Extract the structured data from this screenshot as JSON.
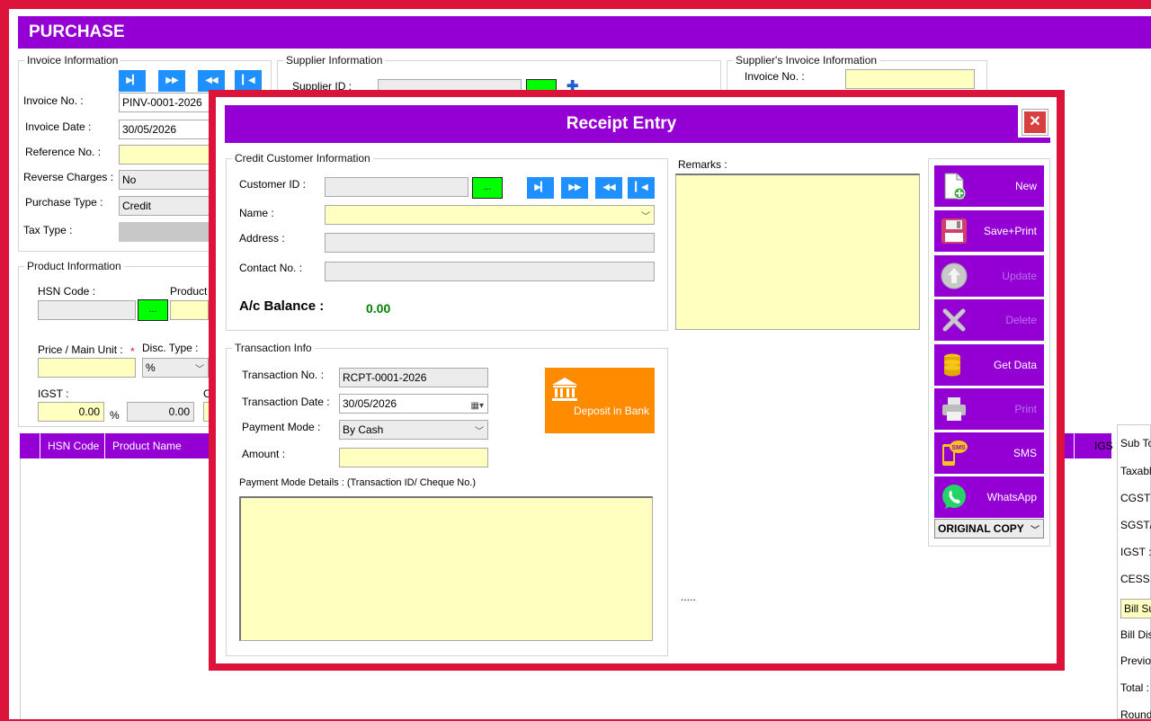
{
  "window": {
    "title": "PURCHASE"
  },
  "invoice": {
    "legend": "Invoice Information",
    "invoice_no_label": "Invoice No. :",
    "invoice_no": "PINV-0001-2026",
    "invoice_date_label": "Invoice Date :",
    "invoice_date": "30/05/2026",
    "reference_no_label": "Reference No. :",
    "reverse_charges_label": "Reverse Charges :",
    "reverse_charges": "No",
    "purchase_type_label": "Purchase Type :",
    "purchase_type": "Credit",
    "tax_type_label": "Tax Type :"
  },
  "supplier": {
    "legend": "Supplier Information",
    "supplier_id_label": "Supplier ID :"
  },
  "supplier_invoice": {
    "legend": "Supplier's Invoice Information",
    "invoice_no_label": "Invoice No. :"
  },
  "product": {
    "legend": "Product Information",
    "hsn_label": "HSN Code :",
    "product_label": "Product",
    "price_label": "Price / Main Unit :",
    "required_mark": "*",
    "disc_type_label": "Disc. Type :",
    "disc_type": "%",
    "igst_label": "IGST :",
    "igst_value": "0.00",
    "percent": "%",
    "second_value": "0.00",
    "c_label": "C"
  },
  "grid": {
    "columns": [
      "HSN Code",
      "Product Name"
    ],
    "right_column": "IGS"
  },
  "totals": {
    "labels": [
      "Sub To",
      "Taxabl",
      "CGST :",
      "SGST/U",
      "IGST :",
      "CESS :",
      "Bill Su",
      "Bill Dis",
      "Previou",
      "Total :",
      "Round"
    ]
  },
  "receipt": {
    "title": "Receipt Entry",
    "customer": {
      "legend": "Credit Customer Information",
      "customer_id_label": "Customer ID :",
      "browse": "...",
      "name_label": "Name :",
      "address_label": "Address :",
      "contact_label": "Contact No. :",
      "balance_label": "A/c Balance :",
      "balance": "0.00"
    },
    "remarks_label": "Remarks :",
    "transaction": {
      "legend": "Transaction Info",
      "no_label": "Transaction No. :",
      "no": "RCPT-0001-2026",
      "date_label": "Transaction Date :",
      "date": "30/05/2026",
      "mode_label": "Payment Mode :",
      "mode": "By Cash",
      "amount_label": "Amount :",
      "details_label": "Payment Mode Details : (Transaction ID/ Cheque No.)",
      "deposit_label": "Deposit in Bank"
    },
    "dots": ".....",
    "actions": {
      "new": "New",
      "save_print": "Save+Print",
      "update": "Update",
      "delete": "Delete",
      "get_data": "Get Data",
      "print": "Print",
      "sms": "SMS",
      "sms_badge": "SMS",
      "whatsapp": "WhatsApp",
      "copy_type": "ORIGINAL COPY"
    }
  },
  "colors": {
    "accent": "#9400d3",
    "border": "#dc143c",
    "nav": "#1e90ff",
    "field_yellow": "#ffffc0",
    "browse_green": "#00ff00",
    "deposit_orange": "#ff8c00",
    "balance_green": "#008000"
  }
}
